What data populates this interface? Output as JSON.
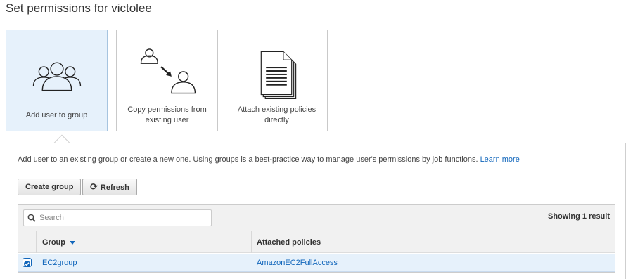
{
  "page": {
    "title": "Set permissions for victolee"
  },
  "options": [
    {
      "label": "Add user to group",
      "icon": "users-group-icon",
      "selected": true
    },
    {
      "label": "Copy permissions from existing user",
      "icon": "copy-user-permissions-icon",
      "selected": false
    },
    {
      "label": "Attach existing policies directly",
      "icon": "policy-document-icon",
      "selected": false
    }
  ],
  "panel": {
    "intro_text": "Add user to an existing group or create a new one. Using groups is a best-practice way to manage user's permissions by job functions.",
    "learn_more": "Learn more",
    "create_group_label": "Create group",
    "refresh_label": "Refresh"
  },
  "table": {
    "search_placeholder": "Search",
    "result_count": "Showing 1 result",
    "columns": [
      "Group",
      "Attached policies"
    ],
    "rows": [
      {
        "group": "EC2group",
        "policies": "AmazonEC2FullAccess",
        "checked": true
      }
    ]
  },
  "colors": {
    "accent": "#1166bb",
    "selected_bg": "#e6f1fb",
    "toolbar_bg": "#f1f1f1"
  }
}
